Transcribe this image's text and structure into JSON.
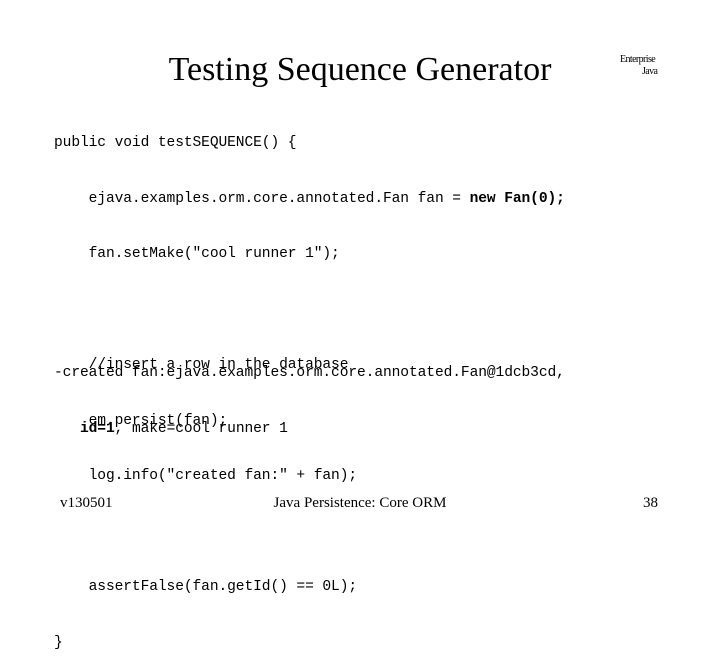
{
  "slide": {
    "title": "Testing Sequence Generator",
    "brand": {
      "line1": "Enterprise",
      "line2": "Java"
    },
    "code": {
      "line1": "public void testSEQUENCE() {",
      "line2_pre": "    ejava.examples.orm.core.annotated.Fan fan = ",
      "line2_bold": "new Fan(0);",
      "line3": "    fan.setMake(\"cool runner 1\");",
      "line4": "",
      "line5": "    //insert a row in the database",
      "line6": "    em.persist(fan);",
      "line7": "    log.info(\"created fan:\" + fan);",
      "line8": "",
      "line9": "    assertFalse(fan.getId() == 0L);",
      "line10": "}"
    },
    "output": {
      "line1": "-created fan:ejava.examples.orm.core.annotated.Fan@1dcb3cd,",
      "line2_indent": "   ",
      "line2_bold": "id=1",
      "line2_rest": ", make=cool runner 1"
    },
    "footer": {
      "version": "v130501",
      "course": "Java Persistence: Core ORM",
      "page": "38"
    }
  }
}
